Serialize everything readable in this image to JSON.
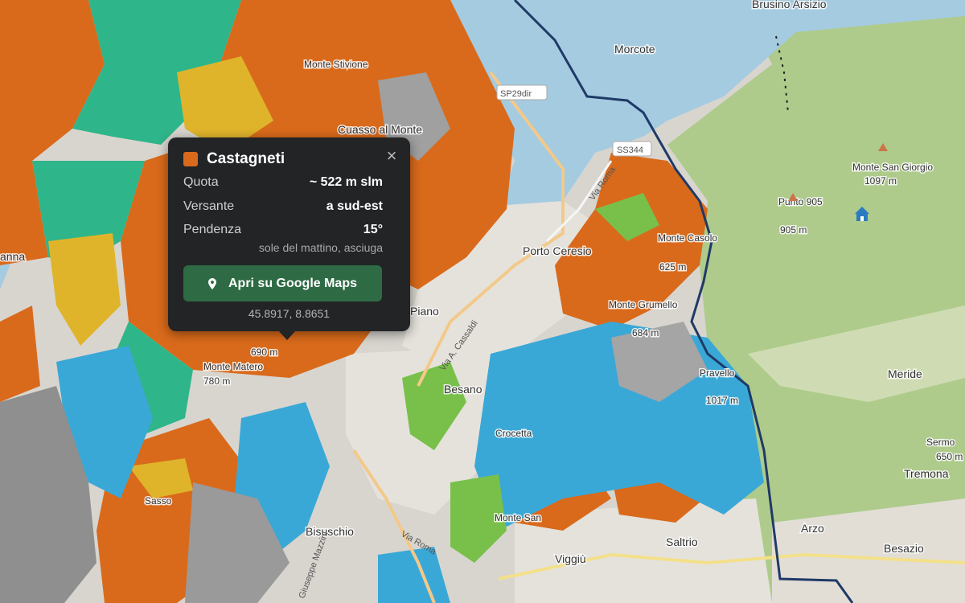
{
  "map": {
    "colors": {
      "lake": "#a5cbe0",
      "forest": "#aecb8b",
      "chestnut": "#d96a1b",
      "beech": "#2fb58a",
      "oak": "#e0b42a",
      "riparian": "#3aa8d6",
      "rock": "#9a9a9a",
      "meadow": "#78c04a",
      "urban": "#e5e2dc",
      "border": "#1f3a66"
    },
    "place_labels": [
      {
        "id": "brusino",
        "text": "Brusino Arsizio"
      },
      {
        "id": "morcote",
        "text": "Morcote"
      },
      {
        "id": "cuasso",
        "text": "Cuasso al Monte"
      },
      {
        "id": "monte-stivione",
        "text": "Monte Stivione"
      },
      {
        "id": "monte-san-giorgio",
        "text": "Monte San Giorgio"
      },
      {
        "id": "monte-san-giorgio-elev",
        "text": "1097 m"
      },
      {
        "id": "punto-905",
        "text": "Punto 905"
      },
      {
        "id": "punto-905-elev",
        "text": "905 m"
      },
      {
        "id": "porto-ceresio",
        "text": "Porto Ceresio"
      },
      {
        "id": "monte-casolo",
        "text": "Monte Casolo"
      },
      {
        "id": "monte-casolo-elev",
        "text": "625 m"
      },
      {
        "id": "monte-grumello",
        "text": "Monte Grumello"
      },
      {
        "id": "monte-grumello-elev",
        "text": "684 m"
      },
      {
        "id": "piano",
        "text": "Piano"
      },
      {
        "id": "besano",
        "text": "Besano"
      },
      {
        "id": "meride",
        "text": "Meride"
      },
      {
        "id": "pravello",
        "text": "Pravello"
      },
      {
        "id": "monte-elev-1017",
        "text": "1017 m"
      },
      {
        "id": "crocetta",
        "text": "Crocetta"
      },
      {
        "id": "monte-matero",
        "text": "Monte Matero"
      },
      {
        "id": "matero-elev",
        "text": "780 m"
      },
      {
        "id": "monte-690",
        "text": "690 m"
      },
      {
        "id": "sasso",
        "text": "Sasso"
      },
      {
        "id": "bisuschio",
        "text": "Bisuschio"
      },
      {
        "id": "monte-san",
        "text": "Monte San"
      },
      {
        "id": "viggiu",
        "text": "Viggiù"
      },
      {
        "id": "saltrio",
        "text": "Saltrio"
      },
      {
        "id": "arzo",
        "text": "Arzo"
      },
      {
        "id": "besazio",
        "text": "Besazio"
      },
      {
        "id": "tremona",
        "text": "Tremona"
      },
      {
        "id": "sermo",
        "text": "Sermo"
      },
      {
        "id": "sermo-elev",
        "text": "650 m"
      },
      {
        "id": "anna",
        "text": "anna"
      }
    ],
    "road_labels": [
      {
        "id": "sp29",
        "text": "SP29dir"
      },
      {
        "id": "ss344",
        "text": "SS344"
      },
      {
        "id": "via-roma-1",
        "text": "Via Roma"
      },
      {
        "id": "via-roma-2",
        "text": "Via Roma"
      },
      {
        "id": "via-cassano",
        "text": "Via A. Cassaldi"
      },
      {
        "id": "via-mazzini",
        "text": "Giuseppe Mazzini"
      }
    ]
  },
  "popup": {
    "title": "Castagneti",
    "swatch_color": "#d96a1b",
    "close_icon": "×",
    "rows": [
      {
        "key": "Quota",
        "value": "~ 522 m slm"
      },
      {
        "key": "Versante",
        "value": "a sud-est"
      },
      {
        "key": "Pendenza",
        "value": "15°"
      }
    ],
    "note": "sole del mattino, asciuga",
    "button_label": "Apri su Google Maps",
    "coords": "45.8917, 8.8651"
  }
}
